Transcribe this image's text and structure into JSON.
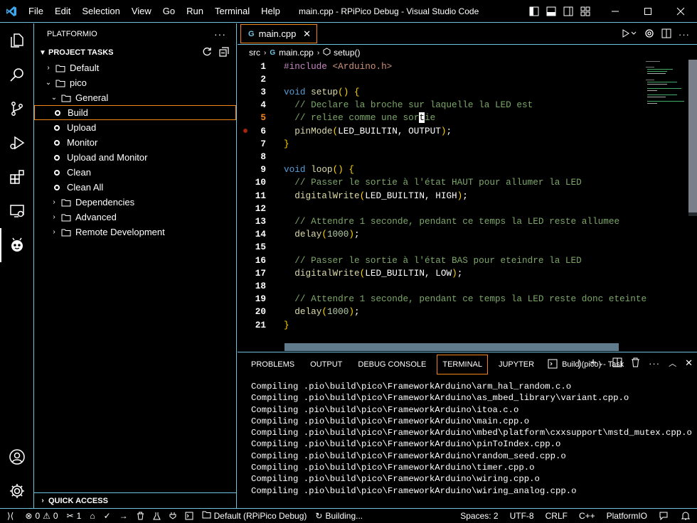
{
  "menu": [
    "File",
    "Edit",
    "Selection",
    "View",
    "Go",
    "Run",
    "Terminal",
    "Help"
  ],
  "window_title": "main.cpp - RPiPico Debug - Visual Studio Code",
  "sidebar": {
    "title": "PLATFORMIO",
    "section": "PROJECT TASKS",
    "items": [
      {
        "label": "Default",
        "kind": "env"
      },
      {
        "label": "pico",
        "kind": "env"
      },
      {
        "label": "General",
        "kind": "folder"
      },
      {
        "label": "Build",
        "kind": "task"
      },
      {
        "label": "Upload",
        "kind": "task"
      },
      {
        "label": "Monitor",
        "kind": "task"
      },
      {
        "label": "Upload and Monitor",
        "kind": "task"
      },
      {
        "label": "Clean",
        "kind": "task"
      },
      {
        "label": "Clean All",
        "kind": "task"
      },
      {
        "label": "Dependencies",
        "kind": "folder"
      },
      {
        "label": "Advanced",
        "kind": "folder"
      },
      {
        "label": "Remote Development",
        "kind": "folder"
      }
    ],
    "quick_access": "QUICK ACCESS"
  },
  "tab": {
    "label": "main.cpp"
  },
  "breadcrumb": {
    "folder": "src",
    "file": "main.cpp",
    "symbol": "setup()"
  },
  "code_lines": [
    "1",
    "2",
    "3",
    "4",
    "5",
    "6",
    "7",
    "8",
    "9",
    "10",
    "11",
    "12",
    "13",
    "14",
    "15",
    "16",
    "17",
    "18",
    "19",
    "20",
    "21"
  ],
  "panel": {
    "tabs": [
      "PROBLEMS",
      "OUTPUT",
      "DEBUG CONSOLE",
      "TERMINAL",
      "JUPYTER"
    ],
    "task": "Build (pico) - Task",
    "terminal_lines": [
      "Compiling .pio\\build\\pico\\FrameworkArduino\\arm_hal_random.c.o",
      "Compiling .pio\\build\\pico\\FrameworkArduino\\as_mbed_library\\variant.cpp.o",
      "Compiling .pio\\build\\pico\\FrameworkArduino\\itoa.c.o",
      "Compiling .pio\\build\\pico\\FrameworkArduino\\main.cpp.o",
      "Compiling .pio\\build\\pico\\FrameworkArduino\\mbed\\platform\\cxxsupport\\mstd_mutex.cpp.o",
      "Compiling .pio\\build\\pico\\FrameworkArduino\\pinToIndex.cpp.o",
      "Compiling .pio\\build\\pico\\FrameworkArduino\\random_seed.cpp.o",
      "Compiling .pio\\build\\pico\\FrameworkArduino\\timer.cpp.o",
      "Compiling .pio\\build\\pico\\FrameworkArduino\\wiring.cpp.o",
      "Compiling .pio\\build\\pico\\FrameworkArduino\\wiring_analog.cpp.o"
    ]
  },
  "status": {
    "errors": "0",
    "warnings": "0",
    "tools": "1",
    "env": "Default (RPiPico Debug)",
    "building": "Building...",
    "spaces": "Spaces: 2",
    "encoding": "UTF-8",
    "eol": "CRLF",
    "lang": "C++",
    "platformio": "PlatformIO"
  },
  "colors": {
    "border": "#6fc3df",
    "active": "#f38518",
    "keyword": "#569cd6",
    "comment": "#7ca668",
    "string": "#ce9178",
    "function": "#dcdcaa"
  }
}
